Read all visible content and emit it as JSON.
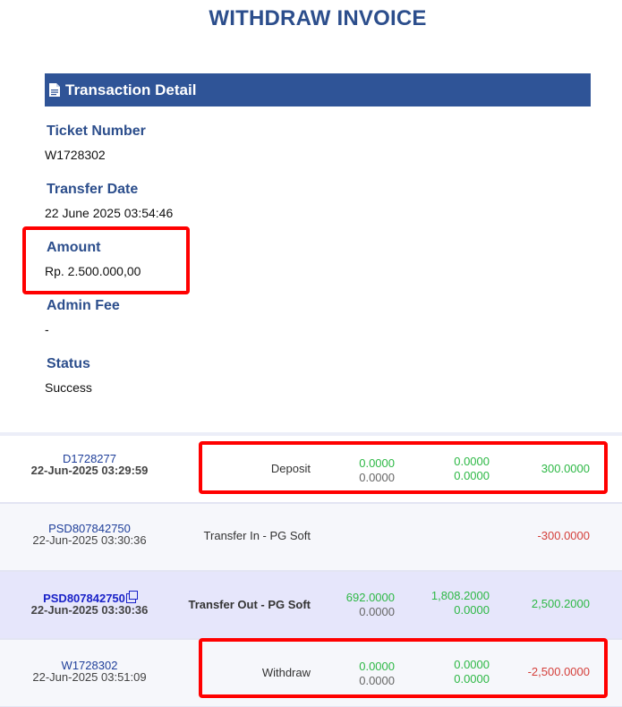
{
  "invoice": {
    "title": "WITHDRAW INVOICE"
  },
  "detail": {
    "header": "Transaction Detail",
    "header_icon": "document-icon",
    "fields": [
      {
        "label": "Ticket Number",
        "value": "W1728302"
      },
      {
        "label": "Transfer Date",
        "value": "22 June 2025 03:54:46"
      },
      {
        "label": "Amount",
        "value": "Rp. 2.500.000,00"
      },
      {
        "label": "Admin Fee",
        "value": "-"
      },
      {
        "label": "Status",
        "value": "Success"
      }
    ]
  },
  "transactions": [
    {
      "code": "D1728277",
      "date": "22-Jun-2025 03:29:59",
      "type": "Deposit",
      "col2_top": "0.0000",
      "col2_bottom": "0.0000",
      "col3_top": "0.0000",
      "col3_bottom": "0.0000",
      "amount": "300.0000"
    },
    {
      "code": "PSD807842750",
      "date": "22-Jun-2025 03:30:36",
      "type": "Transfer In - PG Soft",
      "amount": "-300.0000"
    },
    {
      "code": "PSD807842750",
      "date": "22-Jun-2025 03:30:36",
      "type": "Transfer Out - PG Soft",
      "col2_top": "692.0000",
      "col2_bottom": "0.0000",
      "col3_top": "1,808.2000",
      "col3_bottom": "0.0000",
      "amount": "2,500.2000"
    },
    {
      "code": "W1728302",
      "date": "22-Jun-2025 03:51:09",
      "type": "Withdraw",
      "col2_top": "0.0000",
      "col2_bottom": "0.0000",
      "col3_top": "0.0000",
      "col3_bottom": "0.0000",
      "amount": "-2,500.0000"
    }
  ],
  "colors": {
    "brand": "#2f5497",
    "label": "#2c4e8c",
    "positive": "#2db845",
    "negative": "#d43f3a",
    "highlight": "#ff0000"
  }
}
